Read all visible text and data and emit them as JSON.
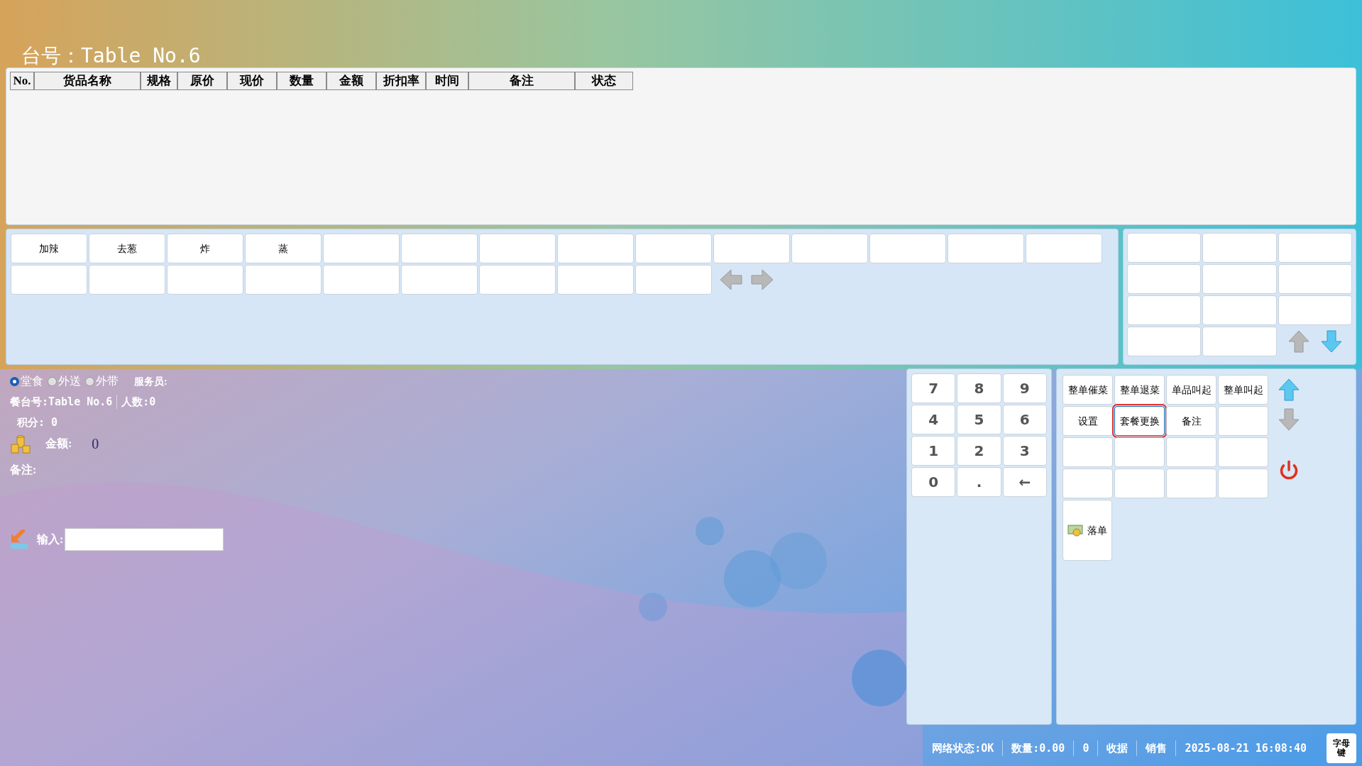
{
  "header": {
    "title": "台号：Table No.6"
  },
  "order_table": {
    "columns": [
      "No.",
      "货品名称",
      "规格",
      "原价",
      "现价",
      "数量",
      "金额",
      "折扣率",
      "时间",
      "备注",
      "状态"
    ]
  },
  "modifier_panel": {
    "buttons": [
      "加辣",
      "去葱",
      "炸",
      "蒸"
    ],
    "arrows": [
      {
        "disabled": true
      },
      {
        "disabled": true
      }
    ]
  },
  "category_panel": {
    "arrows": [
      {
        "disabled": true
      },
      {
        "disabled": false
      }
    ]
  },
  "order_types": [
    {
      "label": "堂食",
      "selected": true
    },
    {
      "label": "外送",
      "selected": false
    },
    {
      "label": "外带",
      "selected": false
    }
  ],
  "waiter_label": "服务员:",
  "info": {
    "table_no": "餐台号:Table No.6",
    "people": "人数:0",
    "points": "积分: 0",
    "amount_label": "金额:",
    "amount_value": "0",
    "remarks_label": "备注:",
    "input_label": "输入:"
  },
  "numpad": [
    "7",
    "8",
    "9",
    "4",
    "5",
    "6",
    "1",
    "2",
    "3",
    "0",
    ".",
    "←"
  ],
  "function_buttons": [
    {
      "label": "整单催菜",
      "selected": false
    },
    {
      "label": "整单退菜",
      "selected": false
    },
    {
      "label": "单品叫起",
      "selected": false
    },
    {
      "label": "整单叫起",
      "selected": false
    },
    {
      "label": "设置",
      "selected": false
    },
    {
      "label": "套餐更换",
      "selected": true
    },
    {
      "label": "备注",
      "selected": false
    }
  ],
  "function_arrows": [
    {
      "disabled": false
    },
    {
      "disabled": true
    }
  ],
  "submit_button": {
    "label": "落单"
  },
  "status_bar": {
    "items": [
      "网络状态:OK",
      "数量:0.00",
      "0",
      "收据",
      "销售",
      "2025-08-21 16:08:40"
    ],
    "key_button": "字母键"
  }
}
